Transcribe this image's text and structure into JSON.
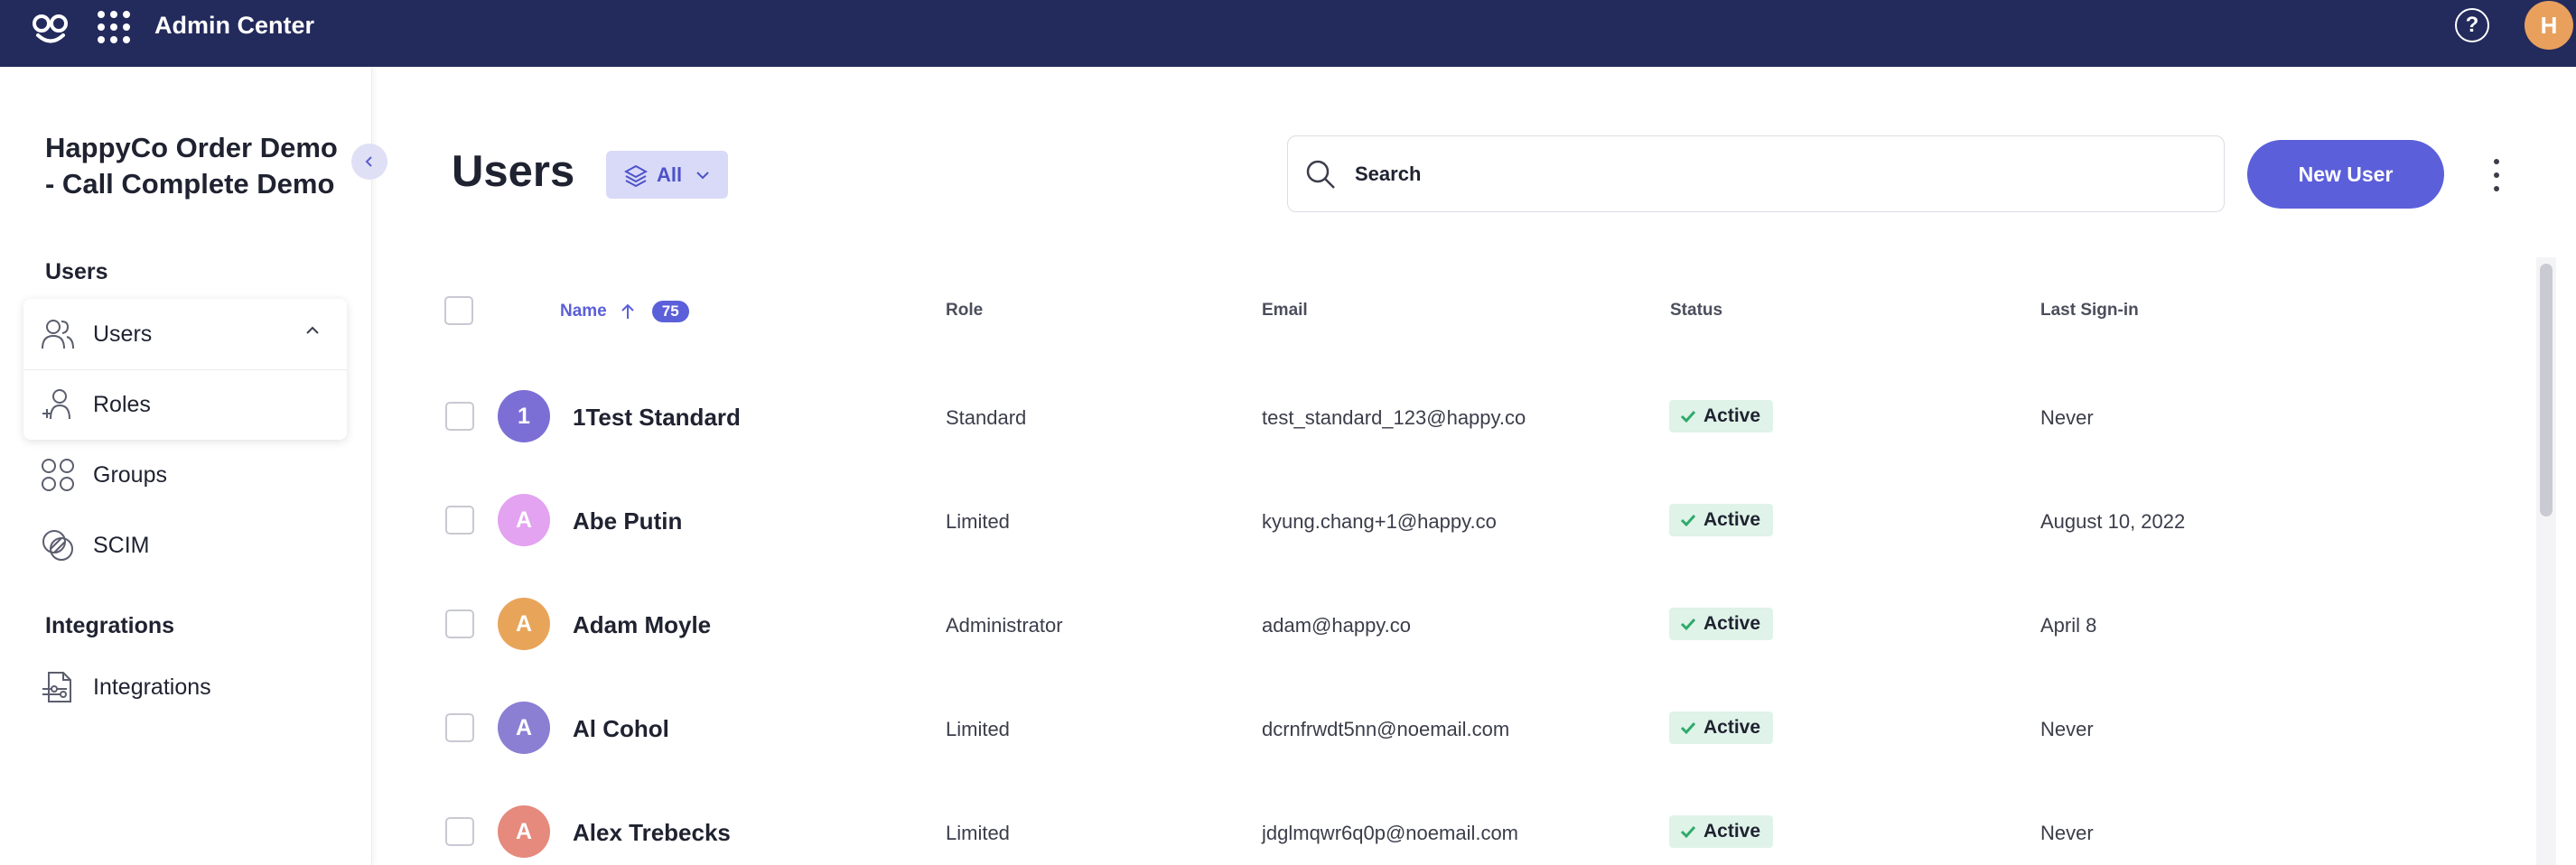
{
  "topbar": {
    "logo_icon": "happyco-logo-icon",
    "apps_icon": "apps-grid-icon",
    "title": "Admin Center",
    "help_icon": "help-icon",
    "help_glyph": "?",
    "avatar_initial": "H",
    "avatar_color": "#e8a05c",
    "background": "#232a5c"
  },
  "sidebar": {
    "org_name": "HappyCo Order Demo - Call Complete Demo",
    "sections": [
      {
        "label": "Users",
        "items": [
          {
            "label": "Users",
            "icon": "users-icon",
            "expanded": true
          },
          {
            "label": "Roles",
            "icon": "add-user-icon"
          },
          {
            "label": "Groups",
            "icon": "groups-icon"
          },
          {
            "label": "SCIM",
            "icon": "scim-icon"
          }
        ]
      },
      {
        "label": "Integrations",
        "items": [
          {
            "label": "Integrations",
            "icon": "integrations-icon"
          }
        ]
      }
    ]
  },
  "main": {
    "title": "Users",
    "filter": {
      "label": "All",
      "icon": "layers-icon"
    },
    "search": {
      "placeholder": "Search",
      "value": ""
    },
    "new_user_label": "New User",
    "accent": "#5b5fd9"
  },
  "table": {
    "columns": {
      "name": "Name",
      "name_count": "75",
      "role": "Role",
      "email": "Email",
      "status": "Status",
      "last_signin": "Last Sign-in"
    },
    "rows": [
      {
        "initial": "1",
        "avatar_color": "#7b6fd6",
        "name": "1Test Standard",
        "role": "Standard",
        "email": "test_standard_123@happy.co",
        "status": "Active",
        "last_signin": "Never"
      },
      {
        "initial": "A",
        "avatar_color": "#e3a3f0",
        "name": "Abe Putin",
        "role": "Limited",
        "email": "kyung.chang+1@happy.co",
        "status": "Active",
        "last_signin": "August 10, 2022"
      },
      {
        "initial": "A",
        "avatar_color": "#e8a55a",
        "name": "Adam Moyle",
        "role": "Administrator",
        "email": "adam@happy.co",
        "status": "Active",
        "last_signin": "April 8"
      },
      {
        "initial": "A",
        "avatar_color": "#8a7fd3",
        "name": "Al Cohol",
        "role": "Limited",
        "email": "dcrnfrwdt5nn@noemail.com",
        "status": "Active",
        "last_signin": "Never"
      },
      {
        "initial": "A",
        "avatar_color": "#e58a7d",
        "name": "Alex Trebecks",
        "role": "Limited",
        "email": "jdglmqwr6q0p@noemail.com",
        "status": "Active",
        "last_signin": "Never"
      }
    ],
    "status_color": "#dff3e8",
    "check_color": "#2eaa6a"
  }
}
